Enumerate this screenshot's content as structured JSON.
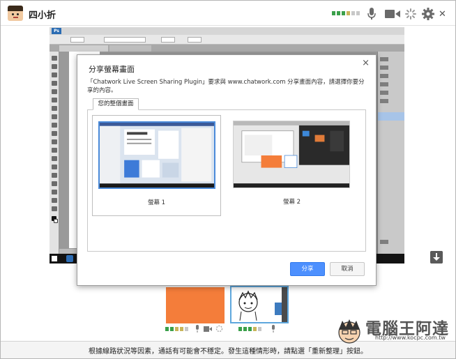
{
  "header": {
    "user_name": "四小折"
  },
  "dialog": {
    "title": "分享螢幕畫面",
    "description": "「Chatwork Live Screen Sharing Plugin」要求與 www.chatwork.com 分享畫面內容，請選擇你要分享的內容。",
    "tab_label": "您的整個畫面",
    "screens": [
      {
        "label": "螢幕 1",
        "selected": true
      },
      {
        "label": "螢幕 2",
        "selected": false
      }
    ],
    "share_label": "分享",
    "cancel_label": "取消"
  },
  "footer": {
    "message": "根據線路狀況等因素，通話有可能會不穩定。發生這種情形時，請點選「重新整理」按鈕。"
  },
  "watermark": {
    "text": "電腦王阿達",
    "url": "http://www.kocpc.com.tw"
  },
  "colors": {
    "accent": "#4d90fe",
    "signal_good": "#3aa04a",
    "signal_mid": "#c9b55a",
    "signal_off": "#c8c8c8",
    "orange_tile": "#f47d3a"
  },
  "icons": [
    "microphone-icon",
    "camera-icon",
    "loading-spinner-icon",
    "gear-icon",
    "close-icon",
    "download-icon"
  ]
}
